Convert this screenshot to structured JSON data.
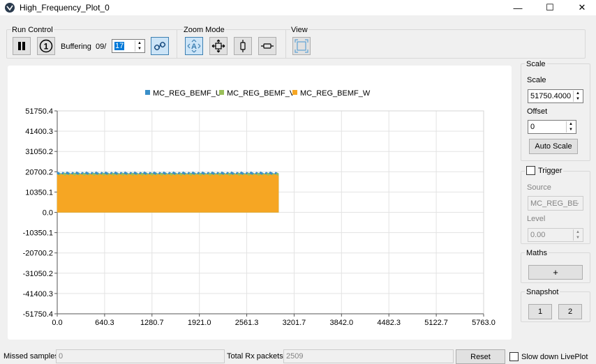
{
  "window": {
    "title": "High_Frequency_Plot_0",
    "minimize": "—",
    "maximize": "☐",
    "close": "✕"
  },
  "run_control": {
    "label": "Run Control",
    "buffering_label": "Buffering",
    "buffer_prefix": "09/",
    "buffer_value": "17"
  },
  "zoom_mode": {
    "label": "Zoom Mode"
  },
  "view": {
    "label": "View"
  },
  "scale_panel": {
    "group_label": "Scale",
    "scale_label": "Scale",
    "scale_value": "51750.4000",
    "offset_label": "Offset",
    "offset_value": "0",
    "auto_scale_label": "Auto Scale"
  },
  "trigger_panel": {
    "label": "Trigger",
    "source_label": "Source",
    "source_value": "MC_REG_BE",
    "level_label": "Level",
    "level_value": "0.00"
  },
  "maths_panel": {
    "label": "Maths",
    "add_label": "+"
  },
  "snapshot_panel": {
    "label": "Snapshot",
    "button1": "1",
    "button2": "2"
  },
  "status_bar": {
    "missed_label": "Missed samples",
    "missed_value": "0",
    "total_rx_label": "Total Rx packets",
    "total_rx_value": "2509",
    "reset_label": "Reset",
    "slow_down_label": "Slow down LivePlot"
  },
  "colors": {
    "series_u": "#3a8fc8",
    "series_v": "#9abf59",
    "series_w": "#f6a623",
    "accent": "#3c7fb1"
  },
  "chart_data": {
    "type": "area",
    "legend_position": "top",
    "grid": true,
    "series": [
      {
        "name": "MC_REG_BEMF_U",
        "color": "#3a8fc8",
        "value_range": [
          0,
          20700.2
        ]
      },
      {
        "name": "MC_REG_BEMF_V",
        "color": "#9abf59",
        "value_range": [
          0,
          20000
        ]
      },
      {
        "name": "MC_REG_BEMF_W",
        "color": "#f6a623",
        "value_range": [
          0,
          19500
        ]
      }
    ],
    "data_x_range": [
      0.0,
      2990.0
    ],
    "xlim": [
      0.0,
      5763.0
    ],
    "ylim": [
      -51750.4,
      51750.4
    ],
    "xticks": [
      "0.0",
      "640.3",
      "1280.7",
      "1921.0",
      "2561.3",
      "3201.7",
      "3842.0",
      "4482.3",
      "5122.7",
      "5763.0"
    ],
    "yticks": [
      "51750.4",
      "41400.3",
      "31050.2",
      "20700.2",
      "10350.1",
      "0.0",
      "-10350.1",
      "-20700.2",
      "-31050.2",
      "-41400.3",
      "-51750.4"
    ]
  }
}
